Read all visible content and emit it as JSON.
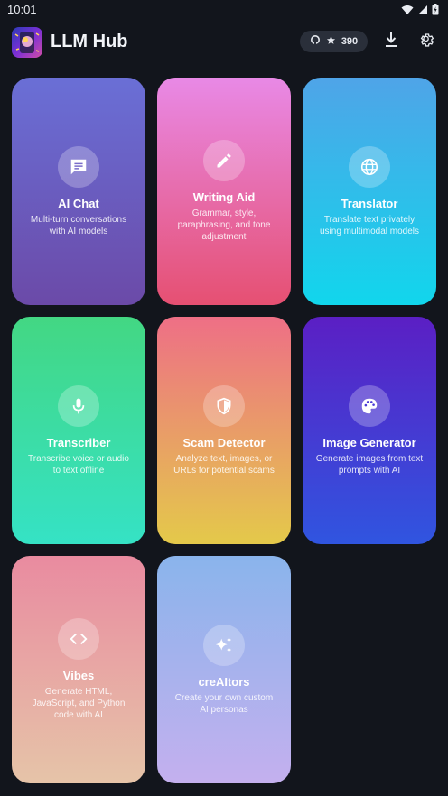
{
  "status_bar": {
    "time": "10:01"
  },
  "header": {
    "title": "LLM Hub",
    "github_stars": "390"
  },
  "cards": [
    {
      "title": "AI Chat",
      "description": "Multi-turn conversations with AI models",
      "icon": "chat-icon"
    },
    {
      "title": "Writing Aid",
      "description": "Grammar, style, paraphrasing, and tone adjustment",
      "icon": "pencil-icon"
    },
    {
      "title": "Translator",
      "description": "Translate text privately using multimodal models",
      "icon": "globe-icon"
    },
    {
      "title": "Transcriber",
      "description": "Transcribe voice or audio to text offline",
      "icon": "microphone-icon"
    },
    {
      "title": "Scam Detector",
      "description": "Analyze text, images, or URLs for potential scams",
      "icon": "shield-icon"
    },
    {
      "title": "Image Generator",
      "description": "Generate images from text prompts with AI",
      "icon": "palette-icon"
    },
    {
      "title": "Vibes",
      "description": "Generate HTML, JavaScript, and Python code with AI",
      "icon": "code-icon"
    },
    {
      "title": "creAItors",
      "description": "Create your own custom AI personas",
      "icon": "sparkles-icon"
    }
  ]
}
